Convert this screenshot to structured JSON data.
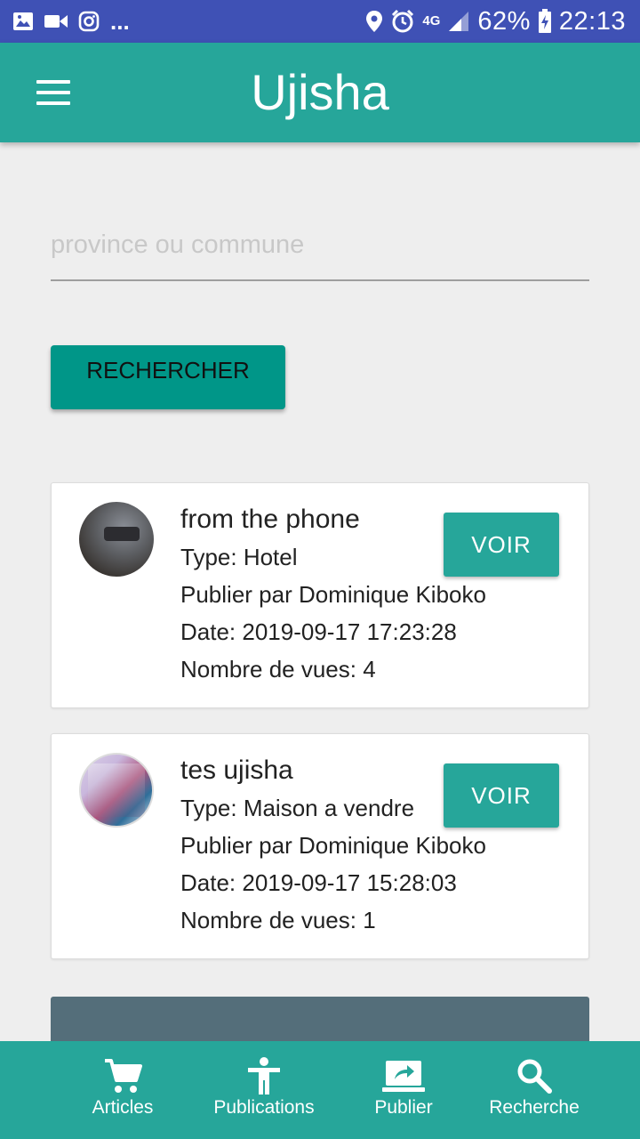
{
  "status_bar": {
    "network": "4G",
    "battery": "62%",
    "time": "22:13",
    "more": "..."
  },
  "app_bar": {
    "title": "Ujisha"
  },
  "search": {
    "placeholder": "province ou commune",
    "value": "",
    "button_label": "RECHERCHER"
  },
  "results": [
    {
      "title": "from the phone",
      "type": "Type: Hotel",
      "author": "Publier par Dominique Kiboko",
      "date": "Date: 2019-09-17 17:23:28",
      "views": "Nombre de vues: 4",
      "button_label": "VOIR"
    },
    {
      "title": "tes ujisha",
      "type": "Type: Maison a vendre",
      "author": "Publier par Dominique Kiboko",
      "date": "Date: 2019-09-17 15:28:03",
      "views": "Nombre de vues: 1",
      "button_label": "VOIR"
    }
  ],
  "bottom_nav": [
    {
      "label": "Articles",
      "icon": "cart-icon"
    },
    {
      "label": "Publications",
      "icon": "accessibility-icon"
    },
    {
      "label": "Publier",
      "icon": "share-screen-icon"
    },
    {
      "label": "Recherche",
      "icon": "search-icon"
    }
  ],
  "colors": {
    "status_bar": "#3f51b5",
    "primary": "#26a69a",
    "button_dark": "#009688",
    "background": "#eeeeee",
    "panel": "#546e7a"
  }
}
